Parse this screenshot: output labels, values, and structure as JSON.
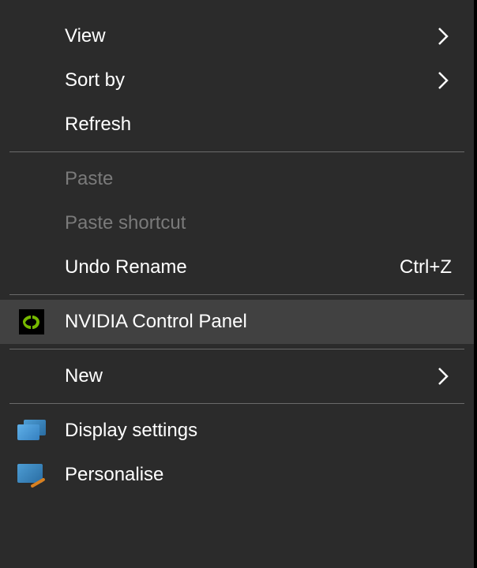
{
  "menu": {
    "view": {
      "label": "View",
      "has_submenu": true
    },
    "sortby": {
      "label": "Sort by",
      "has_submenu": true
    },
    "refresh": {
      "label": "Refresh"
    },
    "paste": {
      "label": "Paste"
    },
    "paste_shortcut": {
      "label": "Paste shortcut"
    },
    "undo": {
      "label": "Undo Rename",
      "shortcut": "Ctrl+Z"
    },
    "nvidia": {
      "label": "NVIDIA Control Panel"
    },
    "new": {
      "label": "New",
      "has_submenu": true
    },
    "display_settings": {
      "label": "Display settings"
    },
    "personalise": {
      "label": "Personalise"
    }
  }
}
